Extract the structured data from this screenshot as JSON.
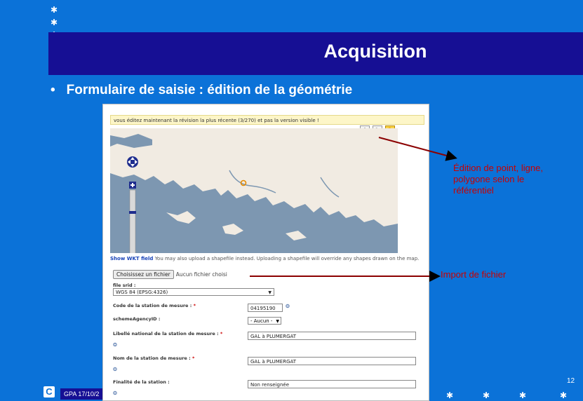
{
  "slide": {
    "title": "Acquisition",
    "bullet": "Formulaire de saisie : édition de la géométrie",
    "bullet_marker": "•",
    "page_number": "12",
    "footer_text": "GPA 17/10/2",
    "footer_logo": "C"
  },
  "annotations": {
    "edit_note": "Édition de point, ligne, polygone selon le référentiel",
    "import_note": "Import de fichier",
    "color": "#c90000"
  },
  "screenshot": {
    "warning": "vous éditez maintenant la révision la plus récente (3/270) et pas la version visible !",
    "toolbar_icons": [
      "navigation-icon",
      "pencil-icon",
      "hand-icon"
    ],
    "wkt_link": "Show WKT field",
    "wkt_text": "You may also upload a shapefile instead. Uploading a shapefile will override any shapes drawn on the map.",
    "file_button": "Choisissez un fichier",
    "file_none": "Aucun fichier choisi",
    "srid_label": "file srid :",
    "srid_value": "WGS 84 (EPSG:4326)",
    "fields": [
      {
        "label": "Code de la station de mesure :",
        "required": "*",
        "value": "04195190"
      },
      {
        "label": "schemeAgencyID :",
        "required": "",
        "value": "- Aucun -"
      },
      {
        "label": "Libellé national de la station de mesure :",
        "required": "*",
        "value": "GAL à PLUMERGAT"
      },
      {
        "label": "Nom de la station de mesure :",
        "required": "*",
        "value": "GAL à PLUMERGAT"
      },
      {
        "label": "Finalité de la station :",
        "required": "",
        "value": "Non renseignée"
      }
    ]
  },
  "colors": {
    "background": "#0b72d8",
    "title_band": "#160f94",
    "sea": "#7d97b1",
    "land": "#f1ebe2"
  }
}
